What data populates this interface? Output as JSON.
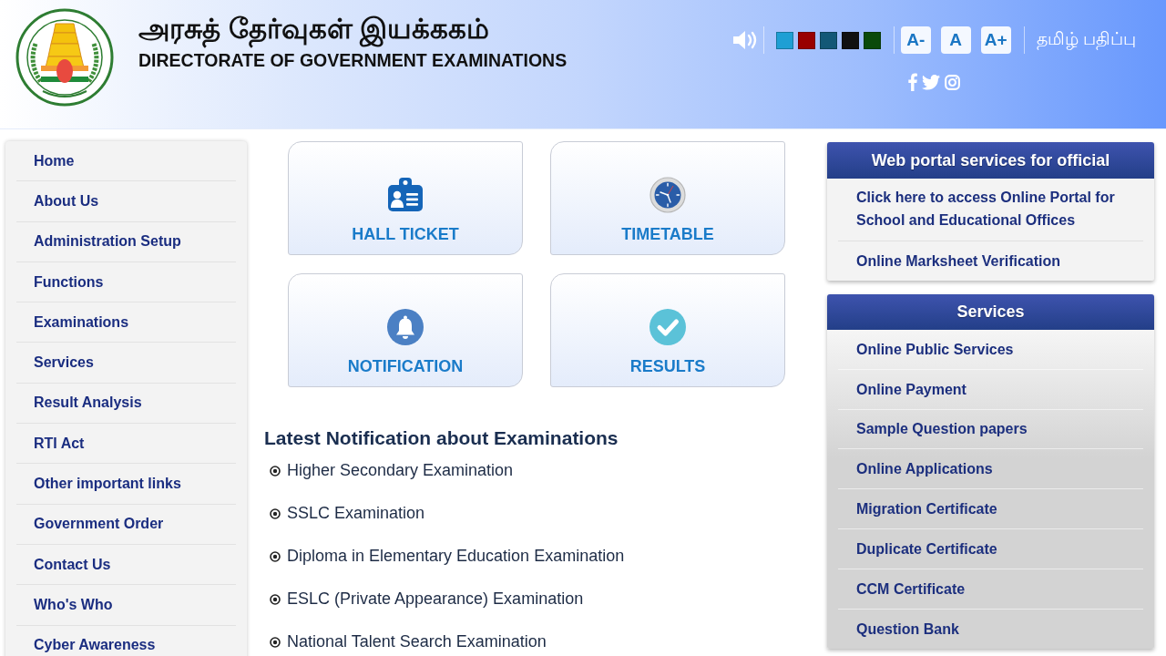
{
  "header": {
    "title_tamil": "அரசுத் தேர்வுகள் இயக்ககம்",
    "title_english": "DIRECTORATE OF GOVERNMENT EXAMINATIONS"
  },
  "toolbar": {
    "theme_colors": [
      {
        "color": "#1e9fd4"
      },
      {
        "color": "#990000"
      },
      {
        "color": "#135876"
      },
      {
        "color": "#111111"
      },
      {
        "color": "#0a4a0a"
      }
    ],
    "font_buttons": [
      "A-",
      "A",
      "A+"
    ],
    "language_link": "தமிழ் பதிப்பு",
    "social": [
      {
        "kind": "facebook"
      },
      {
        "kind": "twitter"
      },
      {
        "kind": "instagram"
      }
    ]
  },
  "sidebar": {
    "items": [
      "Home",
      "About Us",
      "Administration Setup",
      "Functions",
      "Examinations",
      "Services",
      "Result Analysis",
      "RTI Act",
      "Other important links",
      "Government Order",
      "Contact Us",
      "Who's Who",
      "Cyber Awareness"
    ]
  },
  "tiles": [
    {
      "label": "HALL TICKET",
      "kind": "id-card"
    },
    {
      "label": "TIMETABLE",
      "kind": "clock"
    },
    {
      "label": "NOTIFICATION",
      "kind": "bell"
    },
    {
      "label": "RESULTS",
      "kind": "check"
    }
  ],
  "notifications": {
    "title": "Latest Notification about Examinations",
    "items": [
      "Higher Secondary Examination",
      "SSLC Examination",
      "Diploma in Elementary Education Examination",
      "ESLC (Private Appearance) Examination",
      "National Talent Search Examination"
    ]
  },
  "panels": [
    {
      "title": "Web portal services for official",
      "items": [
        "Click here to access Online Portal for School and Educational Offices",
        "Online Marksheet Verification"
      ]
    },
    {
      "title": "Services",
      "items": [
        "Online Public Services",
        "Online Payment",
        "Sample Question papers",
        "Online Applications",
        "Migration Certificate",
        "Duplicate Certificate",
        "CCM Certificate",
        "Question Bank"
      ]
    }
  ]
}
